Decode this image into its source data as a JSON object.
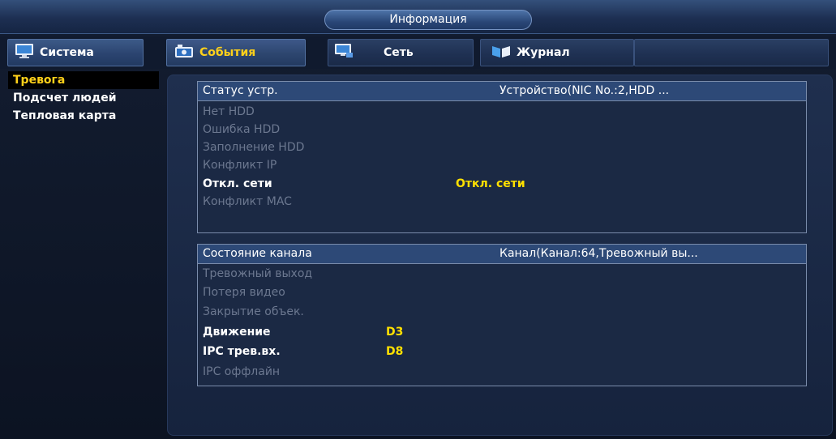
{
  "window": {
    "title": "Информация"
  },
  "tabs": [
    {
      "label": "Система",
      "icon": "monitor-icon",
      "active": false
    },
    {
      "label": "События",
      "icon": "camera-icon",
      "active": true
    },
    {
      "label": "Сеть",
      "icon": "network-icon",
      "active": false
    },
    {
      "label": "Журнал",
      "icon": "journal-icon",
      "active": false
    }
  ],
  "sidebar": {
    "items": [
      {
        "label": "Тревога",
        "active": true
      },
      {
        "label": "Подсчет людей",
        "active": false
      },
      {
        "label": "Тепловая карта",
        "active": false
      }
    ]
  },
  "device_status": {
    "header_label": "Статус устр.",
    "header_value": "Устройство(NIC No.:2,HDD ...",
    "rows": [
      {
        "label": "Нет HDD",
        "value": "",
        "active": false
      },
      {
        "label": "Ошибка HDD",
        "value": "",
        "active": false
      },
      {
        "label": "Заполнение HDD",
        "value": "",
        "active": false
      },
      {
        "label": "Конфликт IP",
        "value": "",
        "active": false
      },
      {
        "label": "Откл. сети",
        "value": "Откл. сети",
        "active": true
      },
      {
        "label": "Конфликт MAC",
        "value": "",
        "active": false
      }
    ]
  },
  "channel_status": {
    "header_label": "Состояние канала",
    "header_value": "Канал(Канал:64,Тревожный вы...",
    "rows": [
      {
        "label": "Тревожный выход",
        "value": "",
        "active": false
      },
      {
        "label": "Потеря видео",
        "value": "",
        "active": false
      },
      {
        "label": "Закрытие объек.",
        "value": "",
        "active": false
      },
      {
        "label": "Движение",
        "value": "D3",
        "active": true
      },
      {
        "label": "IPC трев.вх.",
        "value": "D8",
        "active": true
      },
      {
        "label": "IPC оффлайн",
        "value": "",
        "active": false
      }
    ]
  },
  "colors": {
    "accent_yellow": "#ffd11a",
    "value_yellow": "#ffe000",
    "header_blue": "#2d4977",
    "inactive_text": "#6c7890"
  }
}
